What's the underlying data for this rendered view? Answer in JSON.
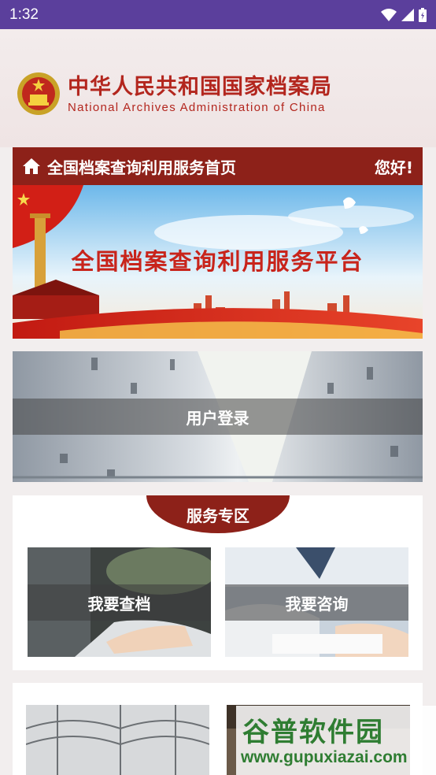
{
  "status_bar": {
    "time": "1:32"
  },
  "header": {
    "org_name_cn": "中华人民共和国国家档案局",
    "org_name_en": "National Archives Administration of China"
  },
  "navbar": {
    "title": "全国档案查询利用服务首页",
    "greeting": "您好!"
  },
  "banner": {
    "title": "全国档案查询利用服务平台"
  },
  "login": {
    "label": "用户登录"
  },
  "service_area": {
    "title": "服务专区",
    "cards": [
      {
        "label": "我要查档"
      },
      {
        "label": "我要咨询"
      }
    ]
  },
  "watermark": {
    "cn": "谷普软件园",
    "en": "www.gupuxiazai.com"
  },
  "colors": {
    "status_bar": "#5b3f9c",
    "brand_red": "#8d2119",
    "org_text_red": "#b3261e",
    "watermark_green": "#2f7d32"
  }
}
